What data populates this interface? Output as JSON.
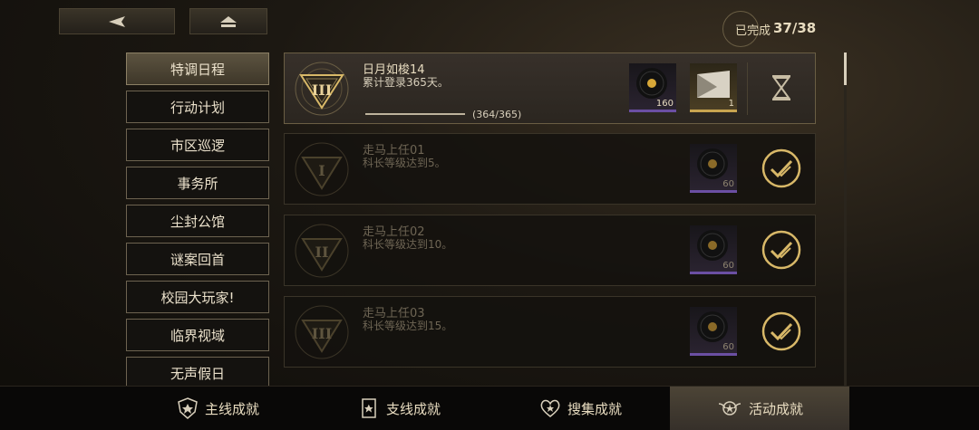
{
  "top": {
    "back_icon": "back-arrow-icon",
    "home_icon": "home-icon",
    "completed_label": "已完成",
    "completed_count": "37/38"
  },
  "categories": [
    {
      "label": "特调日程",
      "active": true
    },
    {
      "label": "行动计划",
      "active": false
    },
    {
      "label": "市区巡逻",
      "active": false
    },
    {
      "label": "事务所",
      "active": false
    },
    {
      "label": "尘封公馆",
      "active": false
    },
    {
      "label": "谜案回首",
      "active": false
    },
    {
      "label": "校园大玩家!",
      "active": false
    },
    {
      "label": "临界视域",
      "active": false
    },
    {
      "label": "无声假日",
      "active": false
    }
  ],
  "achievements": [
    {
      "title": "日月如梭14",
      "desc": "累计登录365天。",
      "progress": "(364/365)",
      "progress_fraction": 0.997,
      "rank": "III",
      "rewards": [
        {
          "icon": "record-disc-icon",
          "qty": "160"
        },
        {
          "icon": "ticket-icon",
          "qty": "1"
        }
      ],
      "status": "in-progress"
    },
    {
      "title": "走马上任01",
      "desc": "科长等级达到5。",
      "rank": "I",
      "rewards": [
        {
          "icon": "record-disc-icon",
          "qty": "60"
        }
      ],
      "status": "completed"
    },
    {
      "title": "走马上任02",
      "desc": "科长等级达到10。",
      "rank": "II",
      "rewards": [
        {
          "icon": "record-disc-icon",
          "qty": "60"
        }
      ],
      "status": "completed"
    },
    {
      "title": "走马上任03",
      "desc": "科长等级达到15。",
      "rank": "III",
      "rewards": [
        {
          "icon": "record-disc-icon",
          "qty": "60"
        }
      ],
      "status": "completed"
    }
  ],
  "bottom_tabs": [
    {
      "label": "主线成就",
      "icon": "shield-icon",
      "active": false
    },
    {
      "label": "支线成就",
      "icon": "card-icon",
      "active": false
    },
    {
      "label": "搜集成就",
      "icon": "heart-icon",
      "active": false
    },
    {
      "label": "活动成就",
      "icon": "winged-emblem-icon",
      "active": true
    }
  ],
  "colors": {
    "accent_gold": "#d8b868",
    "reward_purple": "#6b4fa3"
  }
}
